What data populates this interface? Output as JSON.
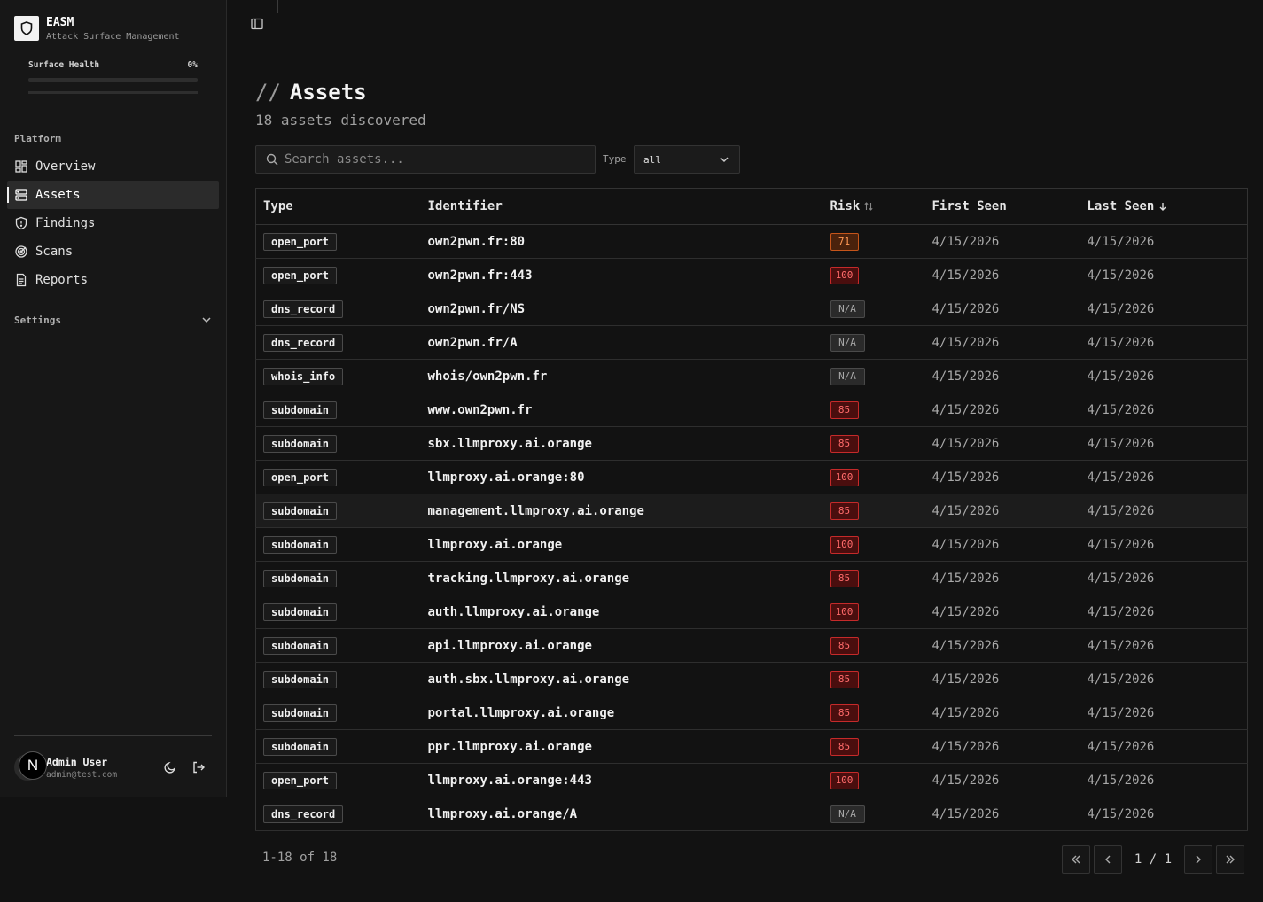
{
  "app": {
    "name": "EASM",
    "subtitle": "Attack Surface Management"
  },
  "health": {
    "label": "Surface Health",
    "value_text": "0%",
    "fraction": 0
  },
  "sidebar": {
    "platform_label": "Platform",
    "items": [
      {
        "label": "Overview",
        "icon": "dashboard-icon"
      },
      {
        "label": "Assets",
        "icon": "server-icon",
        "active": true
      },
      {
        "label": "Findings",
        "icon": "shield-icon"
      },
      {
        "label": "Scans",
        "icon": "radar-icon"
      },
      {
        "label": "Reports",
        "icon": "document-icon"
      }
    ],
    "settings_label": "Settings"
  },
  "user": {
    "name": "Admin User",
    "email": "admin@test.com",
    "badge": "N"
  },
  "page": {
    "title": "Assets",
    "slashes": "//",
    "subtitle": "18 assets discovered"
  },
  "filters": {
    "search_placeholder": "Search assets...",
    "type_label": "Type",
    "type_value": "all"
  },
  "table": {
    "headers": {
      "type": "Type",
      "identifier": "Identifier",
      "risk": "Risk",
      "first_seen": "First Seen",
      "last_seen": "Last Seen"
    },
    "rows": [
      {
        "type": "open_port",
        "identifier": "own2pwn.fr:80",
        "risk": "71",
        "level": "high",
        "first": "4/15/2026",
        "last": "4/15/2026"
      },
      {
        "type": "open_port",
        "identifier": "own2pwn.fr:443",
        "risk": "100",
        "level": "crit",
        "first": "4/15/2026",
        "last": "4/15/2026"
      },
      {
        "type": "dns_record",
        "identifier": "own2pwn.fr/NS",
        "risk": "N/A",
        "level": "na",
        "first": "4/15/2026",
        "last": "4/15/2026"
      },
      {
        "type": "dns_record",
        "identifier": "own2pwn.fr/A",
        "risk": "N/A",
        "level": "na",
        "first": "4/15/2026",
        "last": "4/15/2026"
      },
      {
        "type": "whois_info",
        "identifier": "whois/own2pwn.fr",
        "risk": "N/A",
        "level": "na",
        "first": "4/15/2026",
        "last": "4/15/2026"
      },
      {
        "type": "subdomain",
        "identifier": "www.own2pwn.fr",
        "risk": "85",
        "level": "crit",
        "first": "4/15/2026",
        "last": "4/15/2026"
      },
      {
        "type": "subdomain",
        "identifier": "sbx.llmproxy.ai.orange",
        "risk": "85",
        "level": "crit",
        "first": "4/15/2026",
        "last": "4/15/2026"
      },
      {
        "type": "open_port",
        "identifier": "llmproxy.ai.orange:80",
        "risk": "100",
        "level": "crit",
        "first": "4/15/2026",
        "last": "4/15/2026"
      },
      {
        "type": "subdomain",
        "identifier": "management.llmproxy.ai.orange",
        "risk": "85",
        "level": "crit",
        "first": "4/15/2026",
        "last": "4/15/2026",
        "hl": true
      },
      {
        "type": "subdomain",
        "identifier": "llmproxy.ai.orange",
        "risk": "100",
        "level": "crit",
        "first": "4/15/2026",
        "last": "4/15/2026"
      },
      {
        "type": "subdomain",
        "identifier": "tracking.llmproxy.ai.orange",
        "risk": "85",
        "level": "crit",
        "first": "4/15/2026",
        "last": "4/15/2026"
      },
      {
        "type": "subdomain",
        "identifier": "auth.llmproxy.ai.orange",
        "risk": "100",
        "level": "crit",
        "first": "4/15/2026",
        "last": "4/15/2026"
      },
      {
        "type": "subdomain",
        "identifier": "api.llmproxy.ai.orange",
        "risk": "85",
        "level": "crit",
        "first": "4/15/2026",
        "last": "4/15/2026"
      },
      {
        "type": "subdomain",
        "identifier": "auth.sbx.llmproxy.ai.orange",
        "risk": "85",
        "level": "crit",
        "first": "4/15/2026",
        "last": "4/15/2026"
      },
      {
        "type": "subdomain",
        "identifier": "portal.llmproxy.ai.orange",
        "risk": "85",
        "level": "crit",
        "first": "4/15/2026",
        "last": "4/15/2026"
      },
      {
        "type": "subdomain",
        "identifier": "ppr.llmproxy.ai.orange",
        "risk": "85",
        "level": "crit",
        "first": "4/15/2026",
        "last": "4/15/2026"
      },
      {
        "type": "open_port",
        "identifier": "llmproxy.ai.orange:443",
        "risk": "100",
        "level": "crit",
        "first": "4/15/2026",
        "last": "4/15/2026"
      },
      {
        "type": "dns_record",
        "identifier": "llmproxy.ai.orange/A",
        "risk": "N/A",
        "level": "na",
        "first": "4/15/2026",
        "last": "4/15/2026"
      }
    ]
  },
  "pagination": {
    "range": "1-18 of 18",
    "page": "1 / 1"
  },
  "colors": {
    "critical": "#c52a2a",
    "high": "#c5551a",
    "accent": "#e06c2b"
  }
}
